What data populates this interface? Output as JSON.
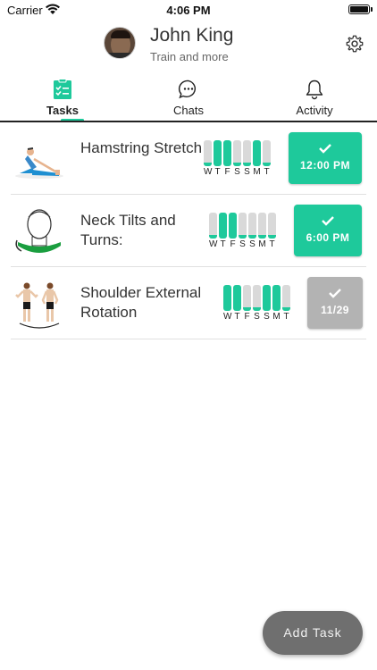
{
  "status_bar": {
    "carrier": "Carrier",
    "time": "4:06 PM"
  },
  "profile": {
    "name": "John King",
    "subtitle": "Train and more"
  },
  "tabs": [
    {
      "label": "Tasks",
      "icon": "clipboard-check-icon",
      "active": true
    },
    {
      "label": "Chats",
      "icon": "chat-bubble-icon",
      "active": false
    },
    {
      "label": "Activity",
      "icon": "bell-icon",
      "active": false
    }
  ],
  "colors": {
    "accent": "#1ec99b",
    "done_gray": "#b3b3b3",
    "bar_off": "#d9d9d9",
    "fab": "#6f6f6f"
  },
  "tasks": [
    {
      "title": "Hamstring Stretch",
      "days": [
        "W",
        "T",
        "F",
        "S",
        "S",
        "M",
        "T"
      ],
      "completed_days": [
        false,
        true,
        true,
        false,
        false,
        true,
        false
      ],
      "action_label": "12:00 PM",
      "action_state": "scheduled"
    },
    {
      "title": "Neck Tilts and Turns:",
      "days": [
        "W",
        "T",
        "F",
        "S",
        "S",
        "M",
        "T"
      ],
      "completed_days": [
        false,
        true,
        true,
        false,
        false,
        false,
        false
      ],
      "action_label": "6:00 PM",
      "action_state": "scheduled"
    },
    {
      "title": "Shoulder External Rotation",
      "days": [
        "W",
        "T",
        "F",
        "S",
        "S",
        "M",
        "T"
      ],
      "completed_days": [
        true,
        true,
        false,
        false,
        true,
        true,
        false
      ],
      "action_label": "11/29",
      "action_state": "done"
    }
  ],
  "add_task_label": "Add Task"
}
